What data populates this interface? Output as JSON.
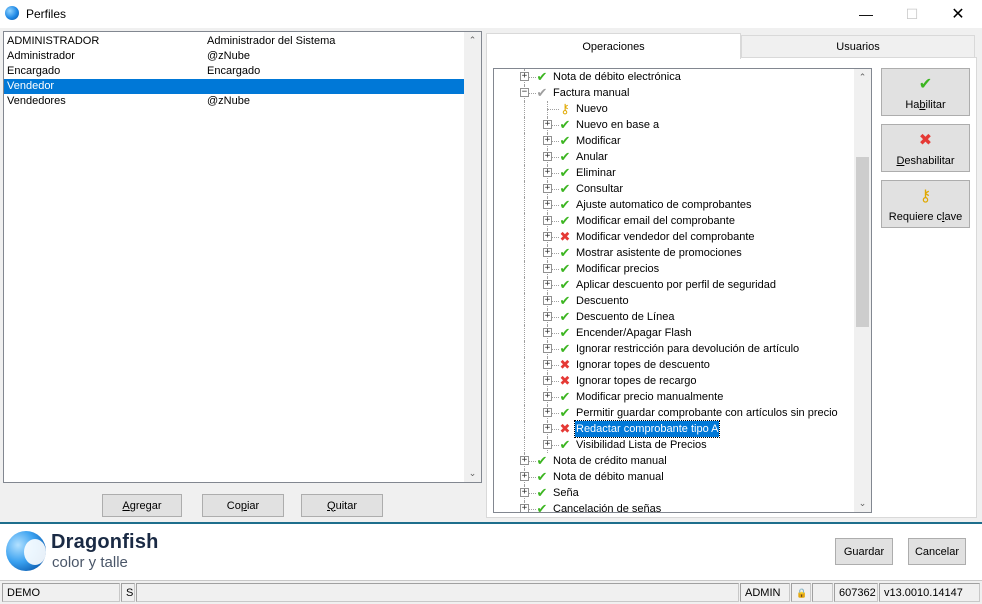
{
  "window": {
    "title": "Perfiles",
    "icon": "dragonfish-app-icon",
    "controls": {
      "minimize": "—",
      "maximize": "☐",
      "close": "✕"
    }
  },
  "profiles": {
    "rows": [
      {
        "name": "ADMINISTRADOR",
        "description": "Administrador del Sistema",
        "selected": false
      },
      {
        "name": "Administrador",
        "description": "@zNube",
        "selected": false
      },
      {
        "name": "Encargado",
        "description": "Encargado",
        "selected": false
      },
      {
        "name": "Vendedor",
        "description": "",
        "selected": true
      },
      {
        "name": "Vendedores",
        "description": "@zNube",
        "selected": false
      }
    ],
    "buttons": {
      "add": {
        "pre": "",
        "mnemonic": "A",
        "post": "gregar"
      },
      "copy": {
        "pre": "Co",
        "mnemonic": "p",
        "post": "iar"
      },
      "remove": {
        "pre": "",
        "mnemonic": "Q",
        "post": "uitar"
      }
    }
  },
  "tabs": [
    {
      "label": "Operaciones",
      "active": true
    },
    {
      "label": "Usuarios",
      "active": false
    }
  ],
  "tree": {
    "rows": [
      {
        "level": 1,
        "expander": "+",
        "icon": "check",
        "label": "Nota de débito electrónica"
      },
      {
        "level": 1,
        "expander": "−",
        "icon": "partial",
        "label": "Factura manual"
      },
      {
        "level": 2,
        "expander": "",
        "icon": "key",
        "label": "Nuevo"
      },
      {
        "level": 2,
        "expander": "+",
        "icon": "check",
        "label": "Nuevo en base a"
      },
      {
        "level": 2,
        "expander": "+",
        "icon": "check",
        "label": "Modificar"
      },
      {
        "level": 2,
        "expander": "+",
        "icon": "check",
        "label": "Anular"
      },
      {
        "level": 2,
        "expander": "+",
        "icon": "check",
        "label": "Eliminar"
      },
      {
        "level": 2,
        "expander": "+",
        "icon": "check",
        "label": "Consultar"
      },
      {
        "level": 2,
        "expander": "+",
        "icon": "check",
        "label": "Ajuste automatico de comprobantes"
      },
      {
        "level": 2,
        "expander": "+",
        "icon": "check",
        "label": "Modificar email del comprobante"
      },
      {
        "level": 2,
        "expander": "+",
        "icon": "cross",
        "label": "Modificar vendedor del comprobante"
      },
      {
        "level": 2,
        "expander": "+",
        "icon": "check",
        "label": "Mostrar asistente de promociones"
      },
      {
        "level": 2,
        "expander": "+",
        "icon": "check",
        "label": "Modificar precios"
      },
      {
        "level": 2,
        "expander": "+",
        "icon": "check",
        "label": "Aplicar descuento por perfil de seguridad"
      },
      {
        "level": 2,
        "expander": "+",
        "icon": "check",
        "label": "Descuento"
      },
      {
        "level": 2,
        "expander": "+",
        "icon": "check",
        "label": "Descuento de Línea"
      },
      {
        "level": 2,
        "expander": "+",
        "icon": "check",
        "label": "Encender/Apagar Flash"
      },
      {
        "level": 2,
        "expander": "+",
        "icon": "check",
        "label": "Ignorar restricción para devolución de artículo"
      },
      {
        "level": 2,
        "expander": "+",
        "icon": "cross",
        "label": "Ignorar topes de descuento"
      },
      {
        "level": 2,
        "expander": "+",
        "icon": "cross",
        "label": "Ignorar topes de recargo"
      },
      {
        "level": 2,
        "expander": "+",
        "icon": "check",
        "label": "Modificar precio manualmente"
      },
      {
        "level": 2,
        "expander": "+",
        "icon": "check",
        "label": "Permitir guardar comprobante con artículos sin precio"
      },
      {
        "level": 2,
        "expander": "+",
        "icon": "cross",
        "label": "Redactar comprobante tipo A",
        "selected": true
      },
      {
        "level": 2,
        "expander": "+",
        "icon": "check",
        "label": "Visibilidad Lista de Precios"
      },
      {
        "level": 1,
        "expander": "+",
        "icon": "check",
        "label": "Nota de crédito manual"
      },
      {
        "level": 1,
        "expander": "+",
        "icon": "check",
        "label": "Nota de débito manual"
      },
      {
        "level": 1,
        "expander": "+",
        "icon": "check",
        "label": "Seña"
      },
      {
        "level": 1,
        "expander": "+",
        "icon": "check",
        "label": "Cancelación de señas"
      }
    ],
    "icon_glyphs": {
      "check": "✔",
      "cross": "✖",
      "partial": "✔",
      "key": "⚷"
    },
    "icon_names": {
      "check": "check-icon",
      "cross": "cross-icon",
      "partial": "partial-check-icon",
      "key": "key-icon"
    }
  },
  "actions": {
    "enable": {
      "glyph": "✔",
      "color": "#3cb521",
      "pre": "Ha",
      "mnemonic": "b",
      "post": "ilitar"
    },
    "disable": {
      "glyph": "✖",
      "color": "#e53935",
      "pre": "",
      "mnemonic": "D",
      "post": "eshabilitar"
    },
    "require_key": {
      "glyph": "⚷",
      "color": "#e0a800",
      "pre": "Requiere c",
      "mnemonic": "l",
      "post": "ave"
    }
  },
  "brand": {
    "name": "Dragonfish",
    "tagline": "color y talle"
  },
  "footer_buttons": {
    "save": "Guardar",
    "cancel": "Cancelar"
  },
  "status_bar": {
    "environment": "DEMO",
    "mode": "S",
    "user": "ADMIN",
    "lock_glyph": "🔒",
    "number": "607362",
    "version": "v13.0010.14147"
  },
  "colors": {
    "selection": "#0078d7",
    "check": "#3cb521",
    "cross": "#e53935",
    "brand_divider": "#1e6e8c"
  }
}
